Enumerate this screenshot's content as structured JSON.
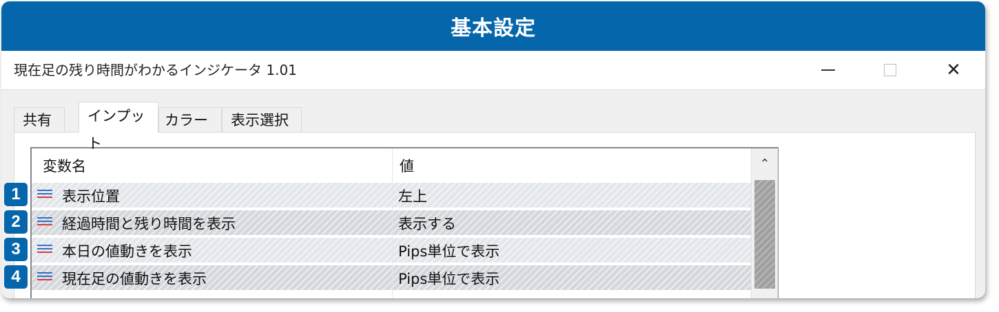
{
  "banner": {
    "title": "基本設定"
  },
  "window": {
    "title": "現在足の残り時間がわかるインジケータ 1.01",
    "min_icon": "minimize-icon",
    "max_icon": "maximize-icon",
    "close_symbol": "✕"
  },
  "tabs": [
    {
      "label": "共有"
    },
    {
      "label": "インプット"
    },
    {
      "label": "カラー"
    },
    {
      "label": "表示選択"
    }
  ],
  "table": {
    "headers": {
      "name": "変数名",
      "value": "値"
    },
    "rows": [
      {
        "badge": "1",
        "name": "表示位置",
        "value": "左上"
      },
      {
        "badge": "2",
        "name": "経過時間と残り時間を表示",
        "value": "表示する"
      },
      {
        "badge": "3",
        "name": "本日の値動きを表示",
        "value": "Pips単位で表示"
      },
      {
        "badge": "4",
        "name": "現在足の値動きを表示",
        "value": "Pips単位で表示"
      }
    ],
    "scroll_up_symbol": "⌃"
  },
  "colors": {
    "accent": "#0566ac",
    "row_icon_blue": "#2f6ec9",
    "row_icon_red": "#d33a3a"
  }
}
